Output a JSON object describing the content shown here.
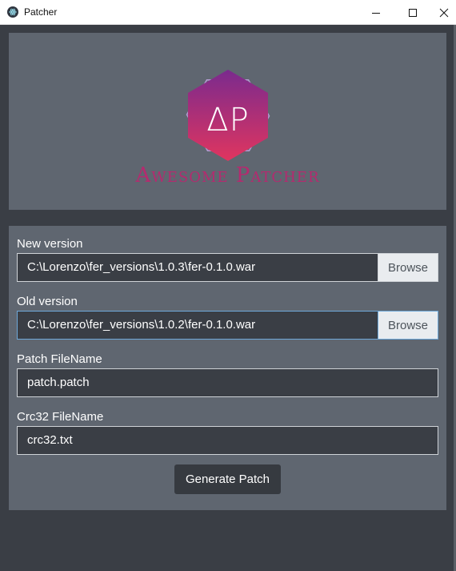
{
  "window": {
    "title": "Patcher",
    "app_icon": "electron-icon",
    "controls": [
      "minimize-icon",
      "maximize-icon",
      "close-icon"
    ]
  },
  "hero": {
    "initials": "ΔP",
    "brand_name": "Awesome Patcher",
    "colors": {
      "gradient_top": "#7a2a8e",
      "gradient_bottom": "#e0355f",
      "outline": "#b39ad1",
      "text": "#b52a6f"
    }
  },
  "form": {
    "new_version": {
      "label": "New version",
      "value": "C:\\Lorenzo\\fer_versions\\1.0.3\\fer-0.1.0.war",
      "button": "Browse"
    },
    "old_version": {
      "label": "Old version",
      "value": "C:\\Lorenzo\\fer_versions\\1.0.2\\fer-0.1.0.war",
      "button": "Browse"
    },
    "patch_filename": {
      "label": "Patch FileName",
      "value": "patch.patch"
    },
    "crc32_filename": {
      "label": "Crc32 FileName",
      "value": "crc32.txt"
    },
    "generate_button": "Generate Patch"
  },
  "colors": {
    "window_bg": "#3a3e45",
    "panel_bg": "#5f6670",
    "focus_border": "#6ea8d8"
  }
}
